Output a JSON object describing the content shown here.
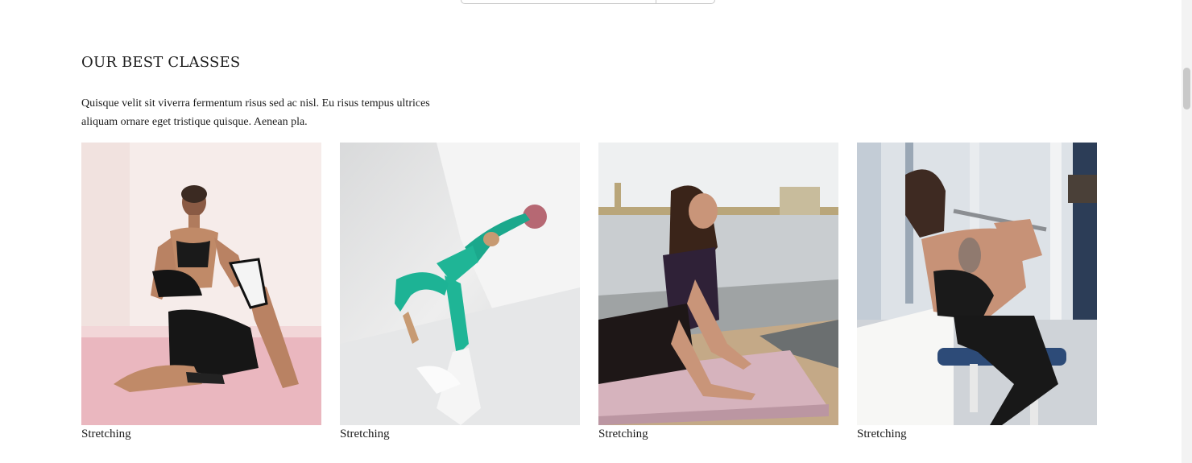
{
  "section": {
    "title": "OUR BEST CLASSES",
    "description": "Quisque velit sit viverra fermentum risus sed ac nisl. Eu risus tempus ultrices aliquam ornare eget tristique quisque. Aenean pla."
  },
  "classes": [
    {
      "caption": "Stretching",
      "image": "woman stretching on pink floor"
    },
    {
      "caption": "Stretching",
      "image": "woman in teal outfit with ball"
    },
    {
      "caption": "Stretching",
      "image": "woman on yoga mat by river"
    },
    {
      "caption": "Stretching",
      "image": "woman on gym pulldown machine"
    }
  ],
  "colors": {
    "text": "#1c1c1c",
    "background": "#ffffff",
    "scrollbar_thumb": "#c9c9c9"
  }
}
